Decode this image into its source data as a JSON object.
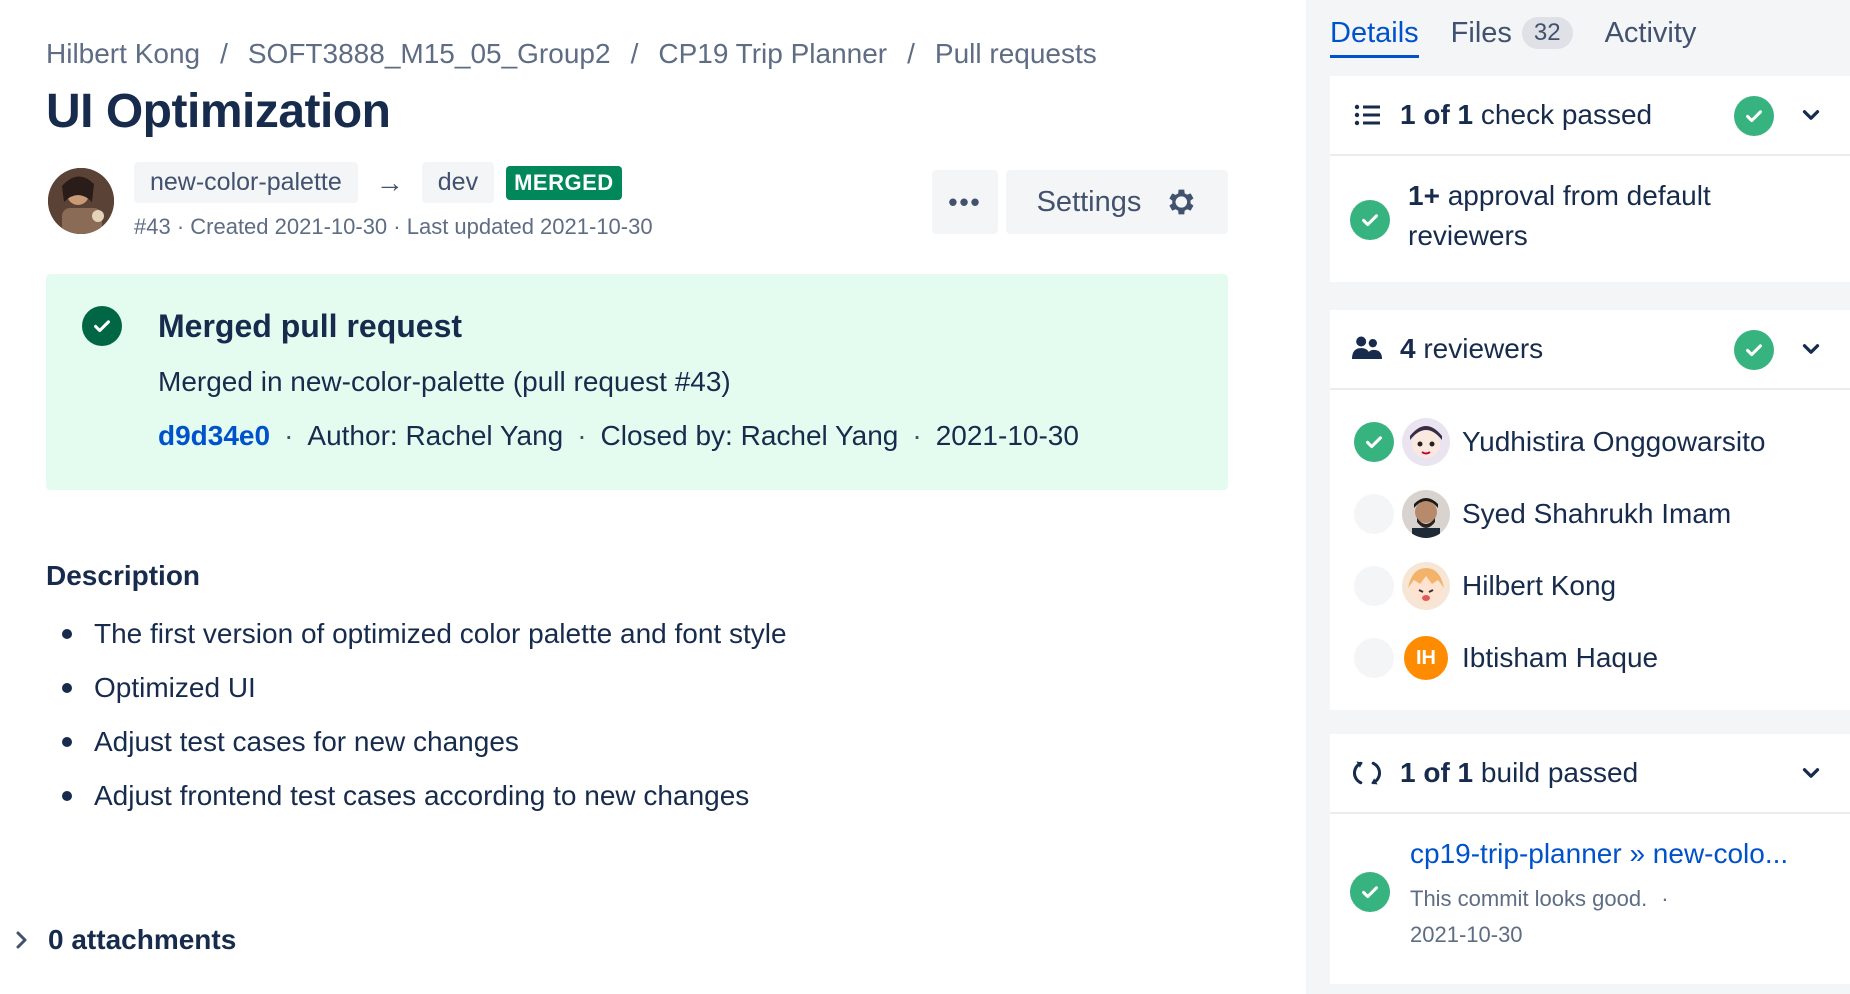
{
  "breadcrumb": {
    "items": [
      "Hilbert Kong",
      "SOFT3888_M15_05_Group2",
      "CP19 Trip Planner",
      "Pull requests"
    ],
    "separator": "/"
  },
  "pr": {
    "title": "UI Optimization",
    "source_branch": "new-color-palette",
    "arrow": "→",
    "target_branch": "dev",
    "status": "MERGED",
    "meta": "#43 · Created 2021-10-30 · Last updated 2021-10-30",
    "more_label": "•••",
    "settings_label": "Settings"
  },
  "merged": {
    "title": "Merged pull request",
    "subtitle": "Merged in new-color-palette (pull request #43)",
    "commit": "d9d34e0",
    "author": "Author: Rachel Yang",
    "closed_by": "Closed by: Rachel Yang",
    "date": "2021-10-30",
    "dot": "·"
  },
  "description": {
    "heading": "Description",
    "items": [
      "The first version of optimized color palette and font style",
      "Optimized UI",
      "Adjust test cases for new changes",
      "Adjust frontend test cases according to new changes"
    ]
  },
  "attachments": {
    "label": "0 attachments"
  },
  "sidebar": {
    "tabs": {
      "details": "Details",
      "files": "Files",
      "files_count": "32",
      "activity": "Activity"
    },
    "checks": {
      "count": "1 of 1",
      "label": " check passed",
      "approval_strong": "1+",
      "approval_rest": " approval from default reviewers"
    },
    "reviewers": {
      "count": "4",
      "label": " reviewers",
      "list": [
        {
          "name": "Yudhistira Onggowarsito",
          "approved": true
        },
        {
          "name": "Syed Shahrukh Imam",
          "approved": false
        },
        {
          "name": "Hilbert Kong",
          "approved": false
        },
        {
          "name": "Ibtisham Haque",
          "approved": false,
          "initials": "IH"
        }
      ]
    },
    "builds": {
      "count": "1 of 1",
      "label": " build passed",
      "build_name": "cp19-trip-planner » new-colo...",
      "build_desc": "This commit looks good.",
      "build_dot": "·",
      "build_date": "2021-10-30"
    }
  },
  "colors": {
    "accent": "#0052cc",
    "success": "#36b37e",
    "merged": "#00875a",
    "merged_panel_bg": "#e3fcef",
    "text": "#172b4d",
    "muted": "#5e6c84"
  }
}
